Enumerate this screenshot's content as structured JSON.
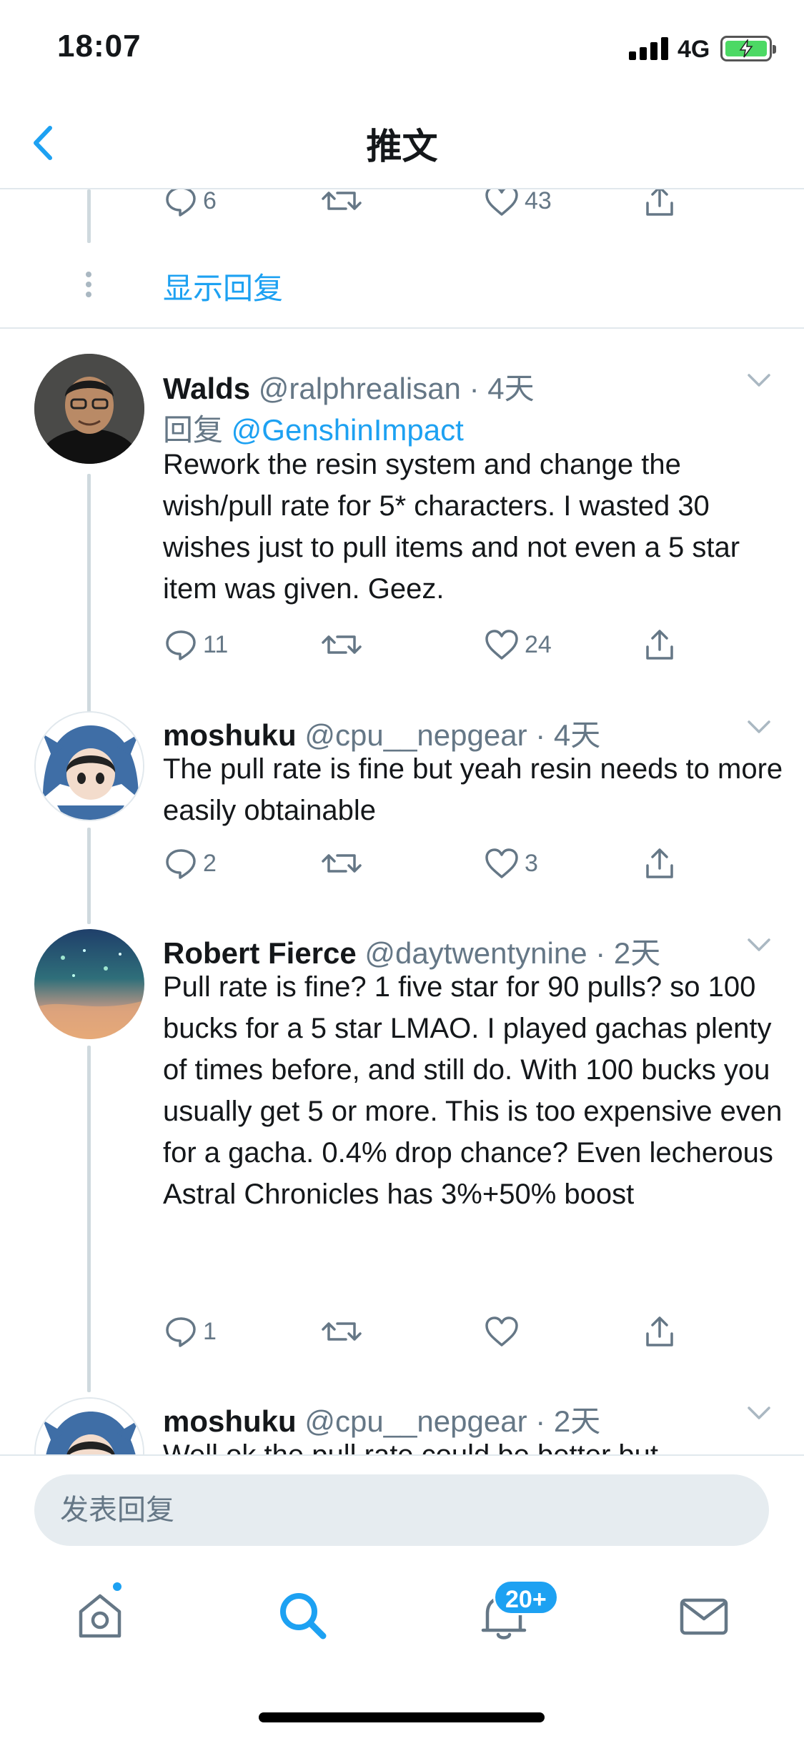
{
  "status_bar": {
    "time": "18:07",
    "network": "4G"
  },
  "nav": {
    "title": "推文"
  },
  "prev_actions": {
    "replies": "6",
    "likes": "43"
  },
  "show_replies": "显示回复",
  "tweets": [
    {
      "name": "Walds",
      "handle": "@ralphrealisan",
      "time": " · 4天",
      "reply_prefix": "回复 ",
      "reply_to": "@GenshinImpact",
      "text": "Rework the resin system and change the wish/pull rate for 5* characters. I wasted 30 wishes just to pull items and not even a 5 star item was given. Geez.",
      "replies": "11",
      "likes": "24"
    },
    {
      "name": "moshuku",
      "handle": "@cpu__nepgear",
      "time": " · 4天",
      "text": "The pull rate is fine but yeah resin needs to more easily obtainable",
      "replies": "2",
      "likes": "3"
    },
    {
      "name": "Robert Fierce",
      "handle": "@daytwentynine",
      "time": " · 2天",
      "text": "Pull rate is fine? 1 five star for 90 pulls? so 100 bucks for a 5 star LMAO. I played gachas plenty of times before, and still do. With 100 bucks you usually get 5 or more. This is too expensive even for a gacha. 0.4% drop chance? Even lecherous Astral Chronicles has 3%+50% boost",
      "replies": "1",
      "likes": ""
    },
    {
      "name": "moshuku",
      "handle": "@cpu__nepgear",
      "time": " · 2天",
      "text": "Well ok the pull rate could be better but"
    }
  ],
  "composer": {
    "placeholder": "发表回复"
  },
  "tab_bar": {
    "notifications_badge": "20+"
  },
  "colors": {
    "accent": "#1da1f2",
    "muted": "#657786",
    "thread_line": "#cfd9de"
  }
}
